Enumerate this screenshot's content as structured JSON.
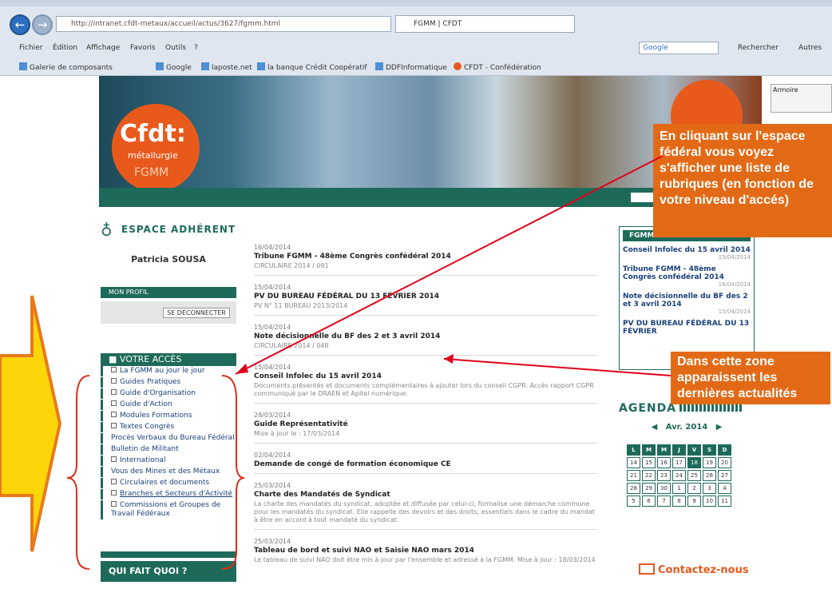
{
  "browser": {
    "address": "http://intranet.cfdt-metaux/accueil/actus/3627/fgmm.html",
    "tab_title": "FGMM | CFDT",
    "menu": [
      "Fichier",
      "Édition",
      "Affichage",
      "Favoris",
      "Outils",
      "?"
    ],
    "favorites": [
      "Galerie de composants",
      "Google",
      "laposte.net",
      "la banque Crédit Coopératif",
      "DDFInformatique",
      "CFDT - Confédération"
    ],
    "search_engine": "Google",
    "search_button": "Rechercher",
    "more_label": "Autres"
  },
  "banner": {
    "logo_main": "Cfdt:",
    "logo_sub": "métallurgie",
    "logo_org": "FGMM",
    "toolbar_label": "Armoire"
  },
  "left": {
    "espace_title": "ESPACE ADHÉRENT",
    "user_name": "Patricia SOUSA",
    "profil_button": "MON PROFIL",
    "deconnect_button": "SE DÉCONNECTER",
    "acces_title": "VOTRE ACCÈS",
    "acces_items": [
      "La FGMM au jour le jour",
      "Guides Pratiques",
      "Guide d'Organisation",
      "Guide d'Action",
      "Modules Formations",
      "Textes Congrès",
      "Procès Verbaux du Bureau Fédéral",
      "Bulletin de Militant",
      "International",
      "Vous des Mines et des Métaux",
      "Circulaires et documents",
      "Branches et Secteurs d'Activité",
      "Commissions et Groupes de Travail Fédéraux"
    ],
    "qui_title": "QUI FAIT QUOI ?"
  },
  "news": [
    {
      "date": "16/04/2014",
      "title": "Tribune FGMM - 48ème Congrès confédéral 2014",
      "sub": "CIRCULAIRE 2014 / 091"
    },
    {
      "date": "15/04/2014",
      "title": "PV DU BUREAU FÉDÉRAL DU 13 FÉVRIER 2014",
      "sub": "PV N° 11 BUREAU 2013/2014"
    },
    {
      "date": "15/04/2014",
      "title": "Note décisionnelle du BF des 2 et 3 avril 2014",
      "sub": "CIRCULAIRE 2014 / 048"
    },
    {
      "date": "15/04/2014",
      "title": "Conseil Infolec du 15 avril 2014",
      "sub": "Documents présentés et documents complémentaires à ajouter lors du conseil CGPR. Accès rapport CGPR communiqué par le DRAEN et Apitel numérique."
    },
    {
      "date": "28/03/2014",
      "title": "Guide Représentativité",
      "sub": "Mise à jour le : 17/03/2014"
    },
    {
      "date": "02/04/2014",
      "title": "Demande de congé de formation économique CE",
      "sub": ""
    },
    {
      "date": "25/03/2014",
      "title": "Charte des Mandatés de Syndicat",
      "sub": "La charte des mandatés du syndicat, adoptée et diffusée par celui-ci, formalise une démarche commune pour les mandatés du syndicat. Elle rappelle des devoirs et des droits, essentiels dans le cadre du mandat à être en accord à tout mandaté du syndicat."
    },
    {
      "date": "25/03/2014",
      "title": "Tableau de bord et suivi NAO et Saisie NAO mars 2014",
      "sub": "Le tableau de suivi NAO doit être mis à jour par l'ensemble et adressé à la FGMM. Mise à jour : 18/03/2014"
    }
  ],
  "right": {
    "box_title": "FGMM",
    "items": [
      {
        "title": "Conseil Infolec du 15 avril 2014",
        "date": "15/04/2014"
      },
      {
        "title": "Tribune FGMM - 48ème Congrès confédéral 2014",
        "date": "16/04/2014"
      },
      {
        "title": "Note décisionnelle du BF des 2 et 3 avril 2014",
        "date": "15/04/2014"
      },
      {
        "title": "PV DU BUREAU FÉDÉRAL DU 13 FÉVRIER",
        "date": ""
      }
    ],
    "agenda_title": "AGENDA",
    "month": "Avr. 2014",
    "calendar_head": [
      "L",
      "M",
      "M",
      "J",
      "V",
      "S",
      "D"
    ],
    "calendar_rows": [
      [
        "14",
        "15",
        "16",
        "17",
        "18",
        "19",
        "20"
      ],
      [
        "21",
        "22",
        "23",
        "24",
        "25",
        "26",
        "27"
      ],
      [
        "28",
        "29",
        "30",
        "1",
        "2",
        "3",
        "4"
      ],
      [
        "5",
        "6",
        "7",
        "8",
        "9",
        "10",
        "11"
      ]
    ],
    "contact": "Contactez-nous"
  },
  "annotations": {
    "callout1": "En cliquant sur l'espace fédéral vous voyez s'afficher une liste de rubriques (en fonction de votre niveau d'accés)",
    "callout2": "Dans cette zone apparaissent les dernières actualités"
  },
  "colors": {
    "accent": "#1e6a5a",
    "orange": "#e26a16",
    "arrow": "#e0001a"
  }
}
